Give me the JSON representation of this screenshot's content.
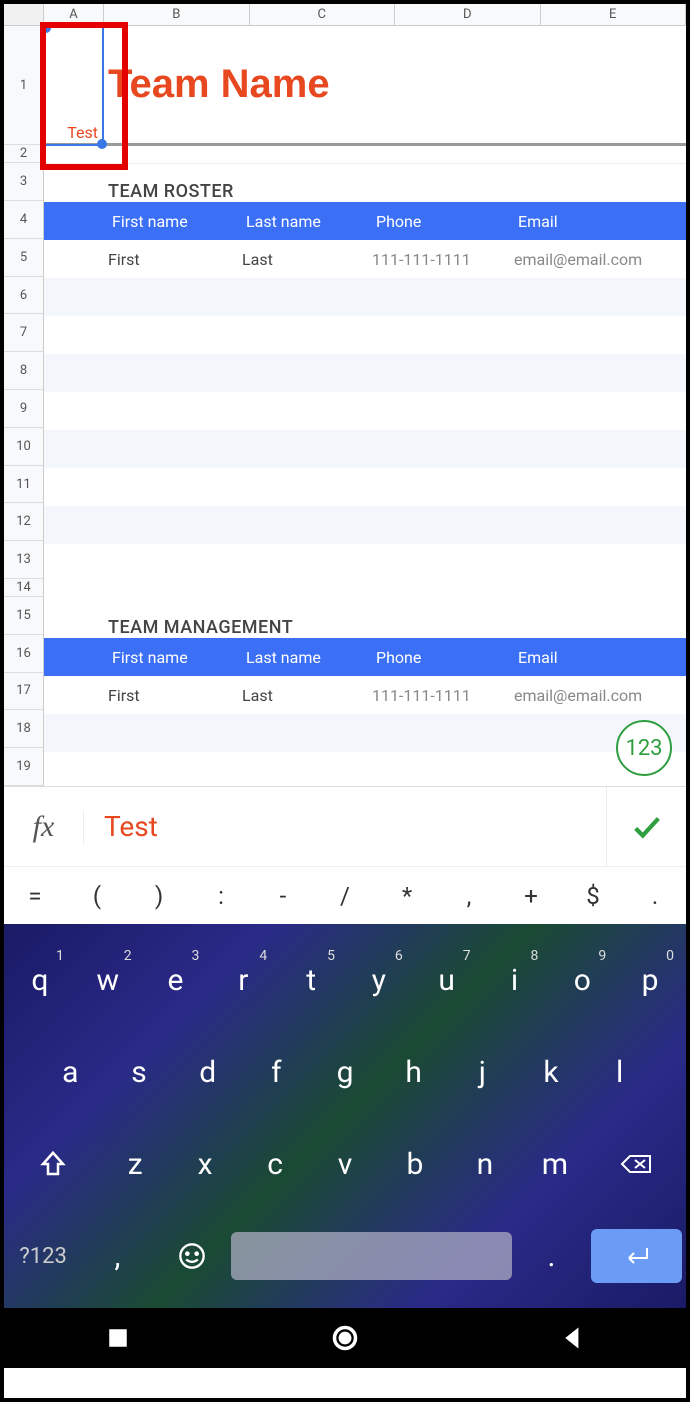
{
  "columns": [
    "A",
    "B",
    "C",
    "D",
    "E"
  ],
  "rows": [
    1,
    2,
    3,
    4,
    5,
    6,
    7,
    8,
    9,
    10,
    11,
    12,
    13,
    14,
    15,
    16,
    17,
    18,
    19
  ],
  "selected_cell": {
    "ref": "A1",
    "value": "Test"
  },
  "title": "Team Name",
  "sections": {
    "roster": {
      "heading": "TEAM ROSTER",
      "headers": [
        "First name",
        "Last name",
        "Phone",
        "Email"
      ],
      "row": {
        "first": "First",
        "last": "Last",
        "phone": "111-111-1111",
        "email": "email@email.com"
      }
    },
    "mgmt": {
      "heading": "TEAM MANAGEMENT",
      "headers": [
        "First name",
        "Last name",
        "Phone",
        "Email"
      ],
      "row": {
        "first": "First",
        "last": "Last",
        "phone": "111-111-1111",
        "email": "email@email.com"
      }
    }
  },
  "fab_label": "123",
  "formula": {
    "fx": "fx",
    "value": "Test"
  },
  "symbols": [
    "=",
    "(",
    ")",
    ":",
    "-",
    "/",
    "*",
    ",",
    "+",
    "$",
    "."
  ],
  "keyboard": {
    "row1": [
      {
        "k": "q",
        "n": "1"
      },
      {
        "k": "w",
        "n": "2"
      },
      {
        "k": "e",
        "n": "3"
      },
      {
        "k": "r",
        "n": "4"
      },
      {
        "k": "t",
        "n": "5"
      },
      {
        "k": "y",
        "n": "6"
      },
      {
        "k": "u",
        "n": "7"
      },
      {
        "k": "i",
        "n": "8"
      },
      {
        "k": "o",
        "n": "9"
      },
      {
        "k": "p",
        "n": "0"
      }
    ],
    "row2": [
      "a",
      "s",
      "d",
      "f",
      "g",
      "h",
      "j",
      "k",
      "l"
    ],
    "row3": [
      "z",
      "x",
      "c",
      "v",
      "b",
      "n",
      "m"
    ],
    "q123": "?123",
    "comma": ",",
    "period": "."
  }
}
